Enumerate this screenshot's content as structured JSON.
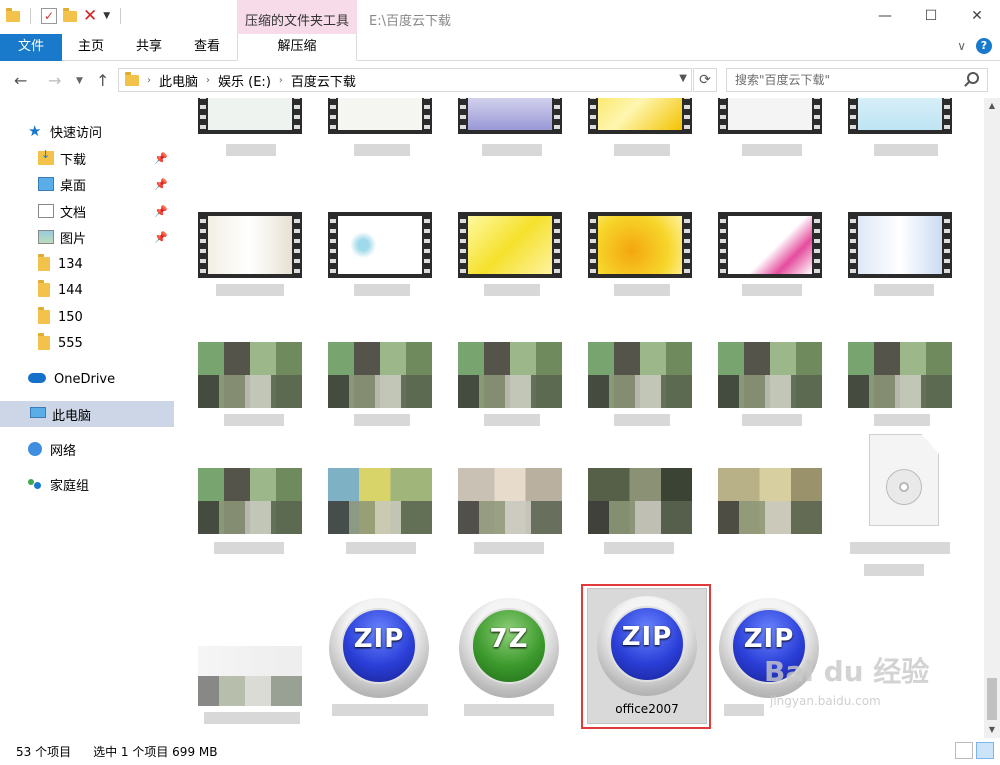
{
  "window": {
    "context_tab_title": "压缩的文件夹工具",
    "path_title": "E:\\百度云下载"
  },
  "ribbon": {
    "tabs": [
      "文件",
      "主页",
      "共享",
      "查看",
      "解压缩"
    ]
  },
  "address": {
    "crumbs": [
      "此电脑",
      "娱乐 (E:)",
      "百度云下载"
    ],
    "search_placeholder": "搜索\"百度云下载\""
  },
  "sidebar": {
    "quick_access": "快速访问",
    "pinned": [
      "下载",
      "桌面",
      "文档",
      "图片"
    ],
    "folders": [
      "134",
      "144",
      "150",
      "555"
    ],
    "onedrive": "OneDrive",
    "this_pc": "此电脑",
    "network": "网络",
    "homegroup": "家庭组"
  },
  "content": {
    "selected_file": "office2007",
    "archive_icons": [
      "ZIP",
      "7Z",
      "ZIP",
      "ZIP"
    ]
  },
  "status": {
    "item_count": "53 个项目",
    "selection": "选中 1 个项目  699 MB"
  },
  "watermark": {
    "brand": "Bai du 经验",
    "url": "jingyan.baidu.com"
  },
  "colors": {
    "accent": "#1979ca",
    "context_tab": "#f7dbe9",
    "selection_frame": "#e13a3a"
  }
}
